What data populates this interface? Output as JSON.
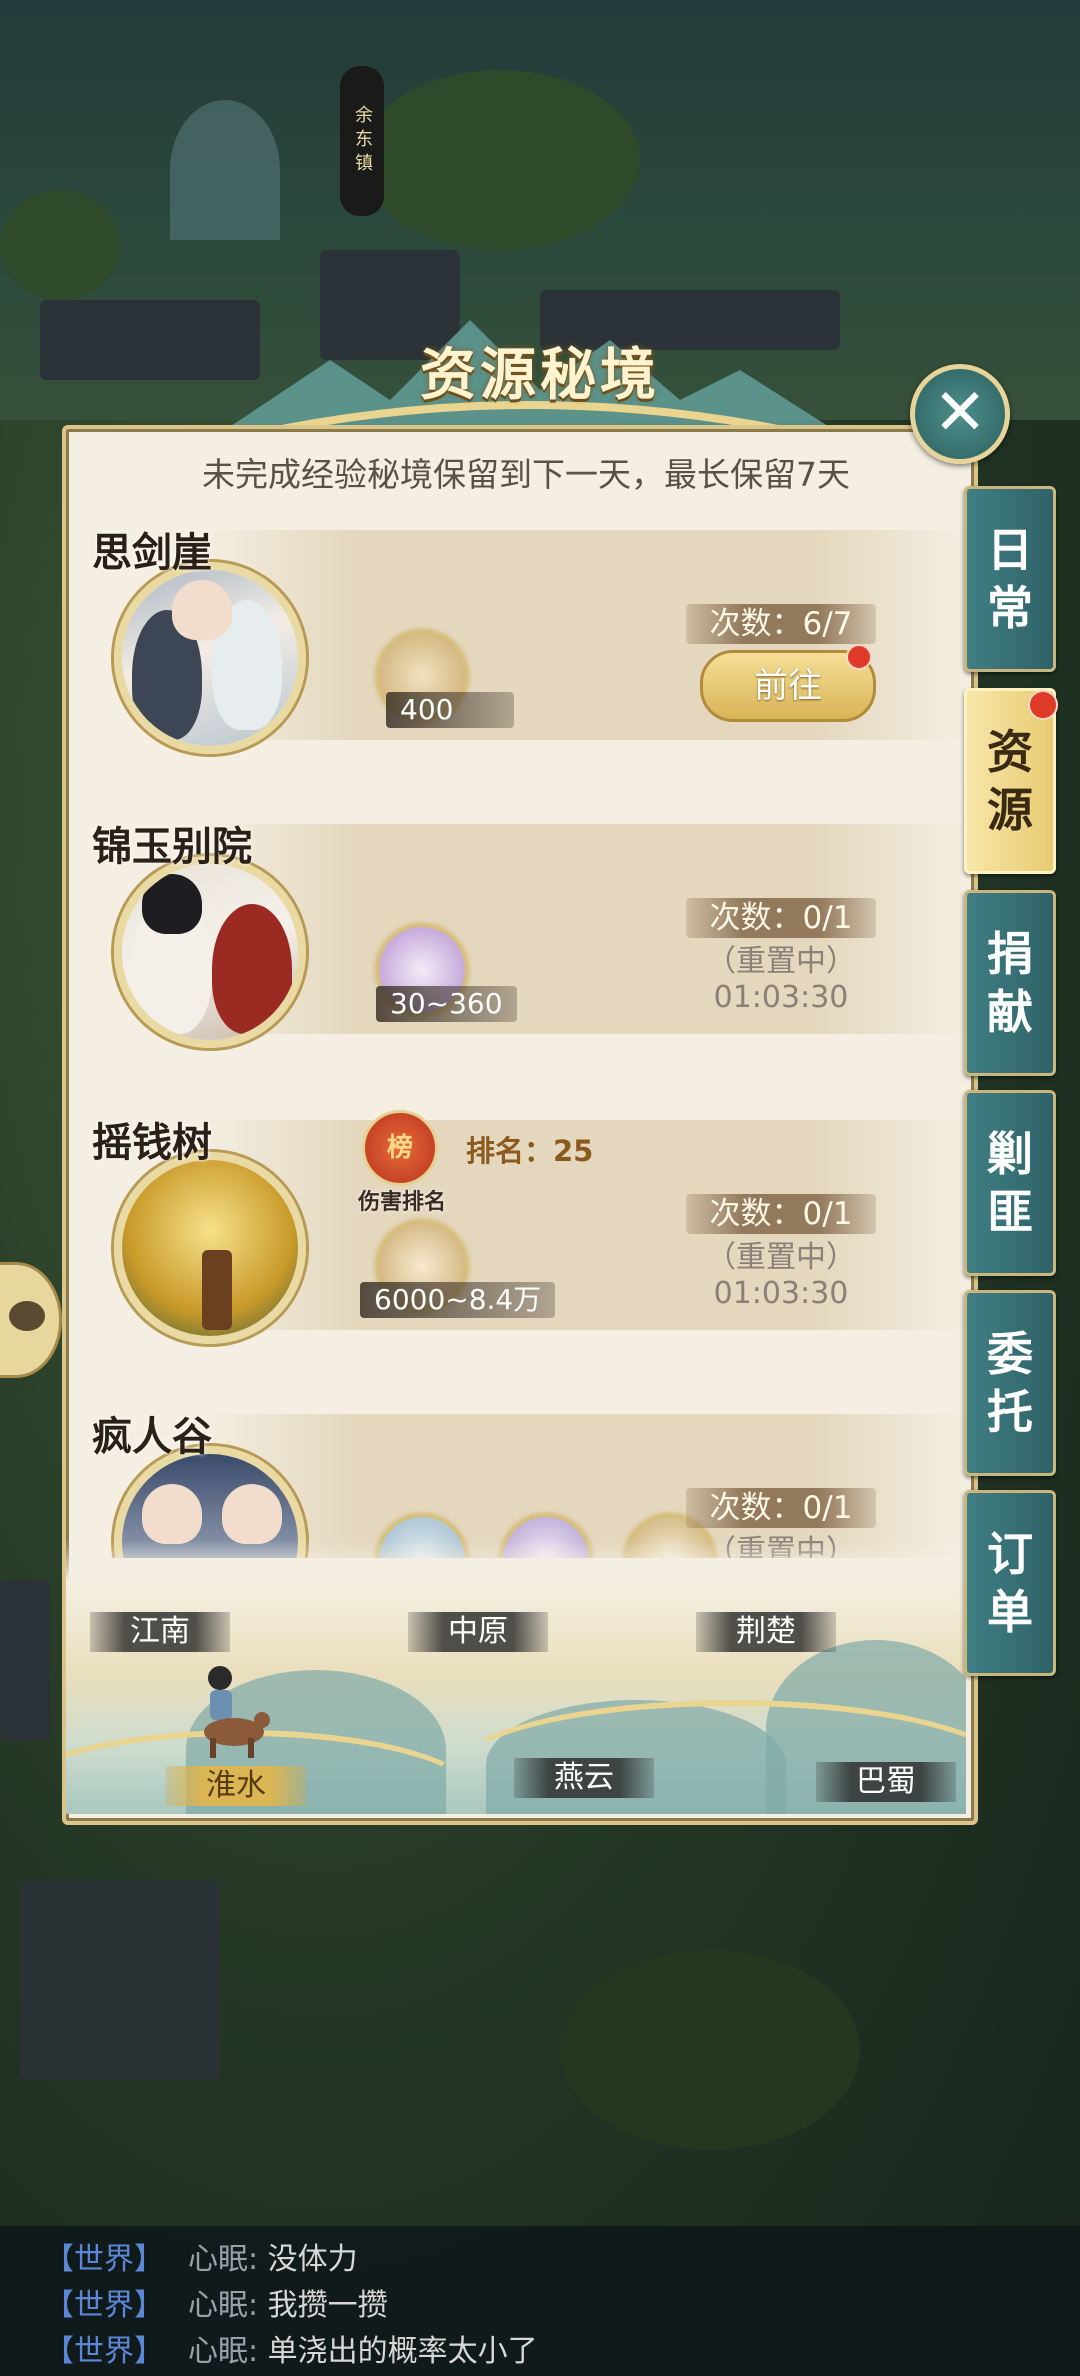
{
  "town_sign": "余东镇",
  "dialog": {
    "title": "资源秘境",
    "close_icon": "close-icon",
    "notice": "未完成经验秘境保留到下一天，最长保留7天"
  },
  "dungeons": [
    {
      "name": "思剑崖",
      "rewards": [
        {
          "icon": "scroll-icon",
          "value": "400"
        }
      ],
      "count": "次数：6/7",
      "button": "前往",
      "has_alert": true
    },
    {
      "name": "锦玉别院",
      "rewards": [
        {
          "icon": "sword-icon",
          "value": "30~360"
        }
      ],
      "count": "次数：0/1",
      "status": "（重置中）",
      "timer": "01:03:30"
    },
    {
      "name": "摇钱树",
      "rank_badge": "榜",
      "rank_caption": "伤害排名",
      "rank_text": "排名：25",
      "rewards": [
        {
          "icon": "coin-icon",
          "value": "6000~8.4万"
        }
      ],
      "count": "次数：0/1",
      "status": "（重置中）",
      "timer": "01:03:30"
    },
    {
      "name": "疯人谷",
      "count": "次数：0/1",
      "status": "（重置中）"
    }
  ],
  "regions": [
    {
      "name": "江南",
      "active": false
    },
    {
      "name": "中原",
      "active": false
    },
    {
      "name": "荆楚",
      "active": false
    },
    {
      "name": "淮水",
      "active": true
    },
    {
      "name": "燕云",
      "active": false
    },
    {
      "name": "巴蜀",
      "active": false
    }
  ],
  "side_tabs": [
    {
      "label_1": "日",
      "label_2": "常",
      "active": false,
      "alert": false
    },
    {
      "label_1": "资",
      "label_2": "源",
      "active": true,
      "alert": true
    },
    {
      "label_1": "捐",
      "label_2": "献",
      "active": false,
      "alert": false
    },
    {
      "label_1": "剿",
      "label_2": "匪",
      "active": false,
      "alert": false
    },
    {
      "label_1": "委",
      "label_2": "托",
      "active": false,
      "alert": false
    },
    {
      "label_1": "订",
      "label_2": "单",
      "active": false,
      "alert": false
    }
  ],
  "chat": [
    {
      "channel": "【世界】",
      "speaker": "心眠:",
      "text": "没体力"
    },
    {
      "channel": "【世界】",
      "speaker": "心眠:",
      "text": "我攒一攒"
    },
    {
      "channel": "【世界】",
      "speaker": "心眠:",
      "text": "单浇出的概率太小了"
    }
  ],
  "colors": {
    "accent_gold": "#d9b456",
    "tab_teal": "#3f7f84",
    "alert_red": "#e03a28",
    "chat_channel": "#5b88d6"
  }
}
